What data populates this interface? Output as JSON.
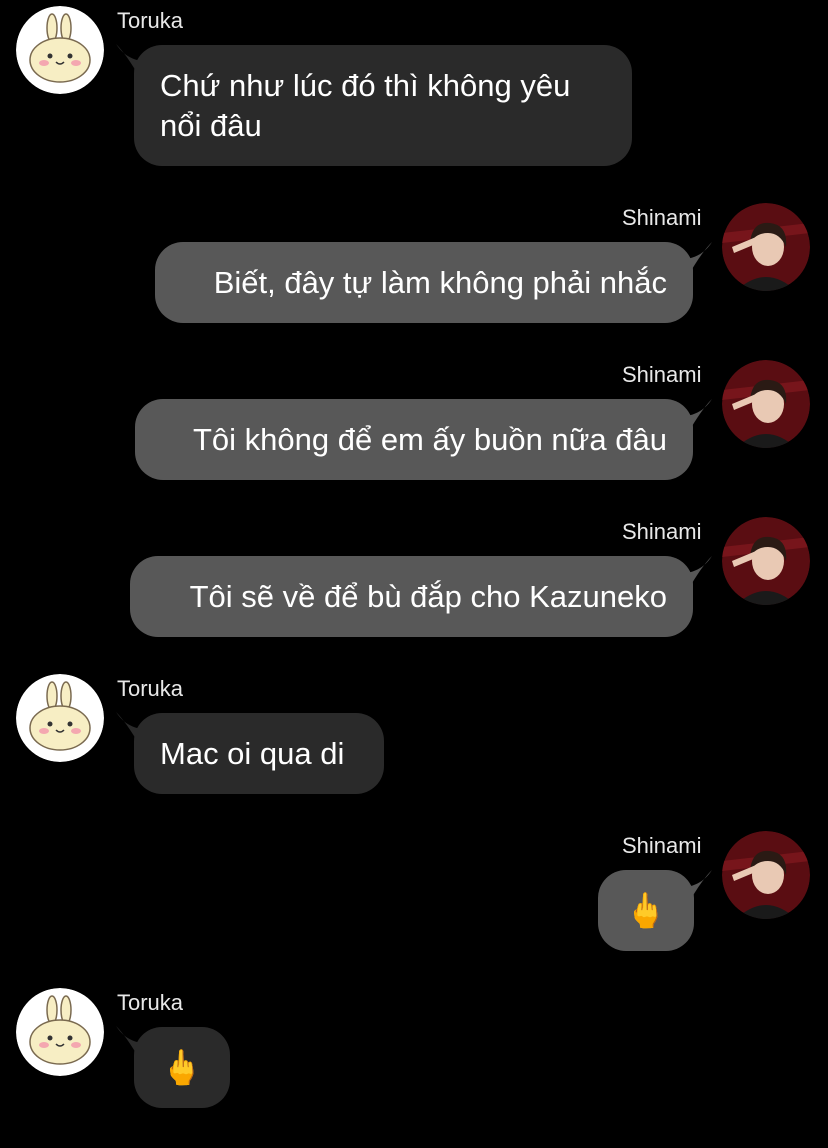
{
  "participants": {
    "toruka": {
      "name": "Toruka",
      "avatar": "bunny-avatar"
    },
    "shinami": {
      "name": "Shinami",
      "avatar": "person-photo-avatar"
    }
  },
  "messages": [
    {
      "sender": "Toruka",
      "text": "Chứ như lúc đó thì không yêu\nnổi đâu"
    },
    {
      "sender": "Shinami",
      "text": "Biết, đây tự làm không phải nhắc"
    },
    {
      "sender": "Shinami",
      "text": "Tôi không để em ấy buồn nữa đâu"
    },
    {
      "sender": "Shinami",
      "text": "Tôi sẽ về để bù đắp cho Kazuneko"
    },
    {
      "sender": "Toruka",
      "text": "Mac oi qua di"
    },
    {
      "sender": "Shinami",
      "text": "🖕"
    },
    {
      "sender": "Toruka",
      "text": "🖕"
    }
  ],
  "colors": {
    "background": "#000000",
    "incoming_bubble": "#2a2a2a",
    "outgoing_bubble": "#585858",
    "text": "#ffffff"
  }
}
